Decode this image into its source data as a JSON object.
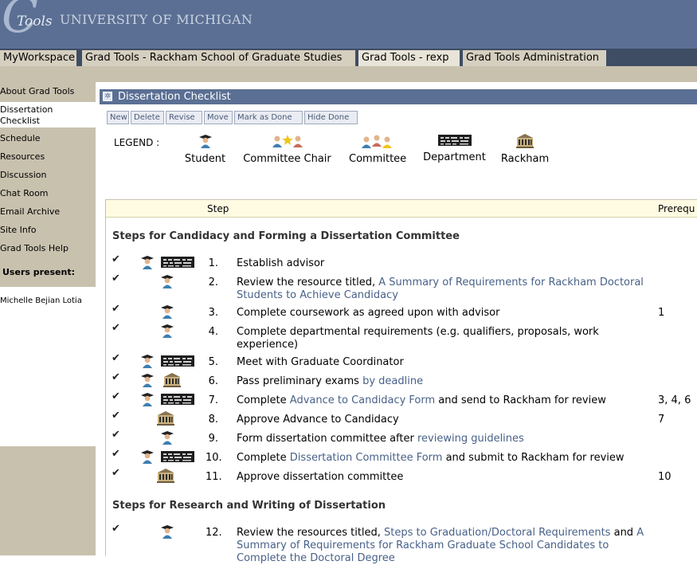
{
  "header": {
    "logo_letter": "C",
    "logo_word": "Tools",
    "university": "UNIVERSITY OF MICHIGAN"
  },
  "tabs": [
    "MyWorkspace",
    "Grad Tools - Rackham School of Graduate Studies",
    "Grad Tools - rexp",
    "Grad Tools Administration"
  ],
  "sidebar": {
    "items": [
      "About Grad Tools",
      "Dissertation Checklist",
      "Schedule",
      "Resources",
      "Discussion",
      "Chat Room",
      "Email Archive",
      "Site Info",
      "Grad Tools Help"
    ],
    "users_present_label": "Users present:",
    "users": [
      "Michelle Bejian Lotia"
    ]
  },
  "tool": {
    "title": "Dissertation Checklist",
    "toolbar": [
      "New",
      "Delete",
      "Revise",
      "Move",
      "Mark as Done",
      "Hide Done"
    ]
  },
  "legend": {
    "label": "LEGEND :",
    "items": [
      "Student",
      "Committee Chair",
      "Committee",
      "Department",
      "Rackham"
    ]
  },
  "table": {
    "col_step": "Step",
    "col_prereq": "Prerequ",
    "sections": [
      "Steps for Candidacy and Forming a Dissertation Committee",
      "Steps for Research and Writing of Dissertation"
    ],
    "check_mark": "✔",
    "rows": [
      {
        "num": "1.",
        "parts": [
          "Establish advisor"
        ],
        "links": [],
        "prereq": "",
        "icons": [
          "student-icon",
          "department-icon"
        ]
      },
      {
        "num": "2.",
        "parts": [
          "Review the resource titled, "
        ],
        "links": [
          "A Summary of Requirements for Rackham Doctoral Students to Achieve Candidacy"
        ],
        "prereq": "",
        "icons": [
          "student-icon"
        ]
      },
      {
        "num": "3.",
        "parts": [
          "Complete coursework as agreed upon with advisor"
        ],
        "links": [],
        "prereq": "1",
        "icons": [
          "student-icon"
        ]
      },
      {
        "num": "4.",
        "parts": [
          "Complete departmental requirements (e.g. qualifiers, proposals, work experience)"
        ],
        "links": [],
        "prereq": "",
        "icons": [
          "student-icon"
        ]
      },
      {
        "num": "5.",
        "parts": [
          "Meet with Graduate Coordinator"
        ],
        "links": [],
        "prereq": "",
        "icons": [
          "student-icon",
          "department-icon"
        ]
      },
      {
        "num": "6.",
        "parts": [
          "Pass preliminary exams "
        ],
        "links": [
          "by deadline"
        ],
        "prereq": "",
        "icons": [
          "student-icon",
          "rackham-icon"
        ]
      },
      {
        "num": "7.",
        "parts": [
          "Complete ",
          " and send to Rackham for review"
        ],
        "links": [
          "Advance to Candidacy Form"
        ],
        "prereq": "3, 4, 6",
        "icons": [
          "student-icon",
          "department-icon"
        ]
      },
      {
        "num": "8.",
        "parts": [
          "Approve Advance to Candidacy"
        ],
        "links": [],
        "prereq": "7",
        "icons": [
          "rackham-icon"
        ]
      },
      {
        "num": "9.",
        "parts": [
          "Form dissertation committee after "
        ],
        "links": [
          "reviewing guidelines"
        ],
        "prereq": "",
        "icons": [
          "student-icon"
        ]
      },
      {
        "num": "10.",
        "parts": [
          "Complete ",
          " and submit to Rackham for review"
        ],
        "links": [
          "Dissertation Committee Form"
        ],
        "prereq": "",
        "icons": [
          "student-icon",
          "department-icon"
        ]
      },
      {
        "num": "11.",
        "parts": [
          "Approve dissertation committee"
        ],
        "links": [],
        "prereq": "10",
        "icons": [
          "rackham-icon"
        ]
      },
      {
        "num": "12.",
        "parts": [
          "Review the resources titled, ",
          " and "
        ],
        "links": [
          "Steps to Graduation/Doctoral Requirements",
          "A Summary of Requirements for Rackham Graduate School Candidates to Complete the Doctoral Degree"
        ],
        "prereq": "",
        "icons": [
          "student-icon"
        ]
      }
    ]
  },
  "colors": {
    "header": "#5a6f93",
    "sidebar": "#c8c1ae",
    "link": "#486188"
  }
}
